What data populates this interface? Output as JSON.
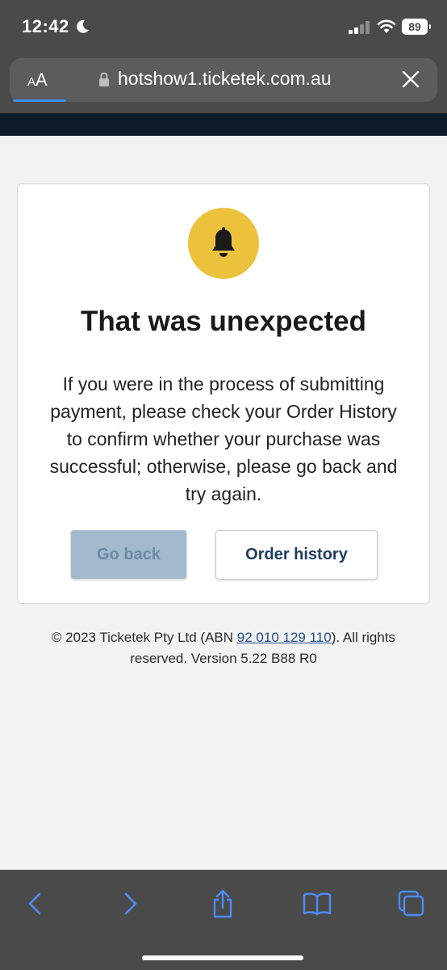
{
  "status_bar": {
    "time": "12:42",
    "battery": "89"
  },
  "browser": {
    "aa_small": "A",
    "aa_large": "A",
    "url": "hotshow1.ticketek.com.au"
  },
  "dialog": {
    "title": "That was unexpected",
    "message": "If you were in the process of submitting payment, please check your Order History to confirm whether your purchase was successful; otherwise, please go back and try again.",
    "go_back_label": "Go back",
    "order_history_label": "Order history"
  },
  "footer": {
    "prefix": "© 2023 Ticketek Pty Ltd (ABN ",
    "abn": "92 010 129 110",
    "suffix": "). All rights reserved. Version 5.22 B88 R0"
  },
  "colors": {
    "chrome": "#4a4a4a",
    "header": "#0d1b2a",
    "bell_circle": "#ecc23c",
    "primary_disabled": "#a3b9cd",
    "link": "#1f4f8f",
    "toolbar_icon": "#4b8df8"
  },
  "icons": {
    "status": [
      "moon-icon",
      "signal-icon",
      "wifi-icon"
    ],
    "toolbar": [
      "back-icon",
      "forward-icon",
      "share-icon",
      "bookmarks-icon",
      "tabs-icon"
    ]
  }
}
